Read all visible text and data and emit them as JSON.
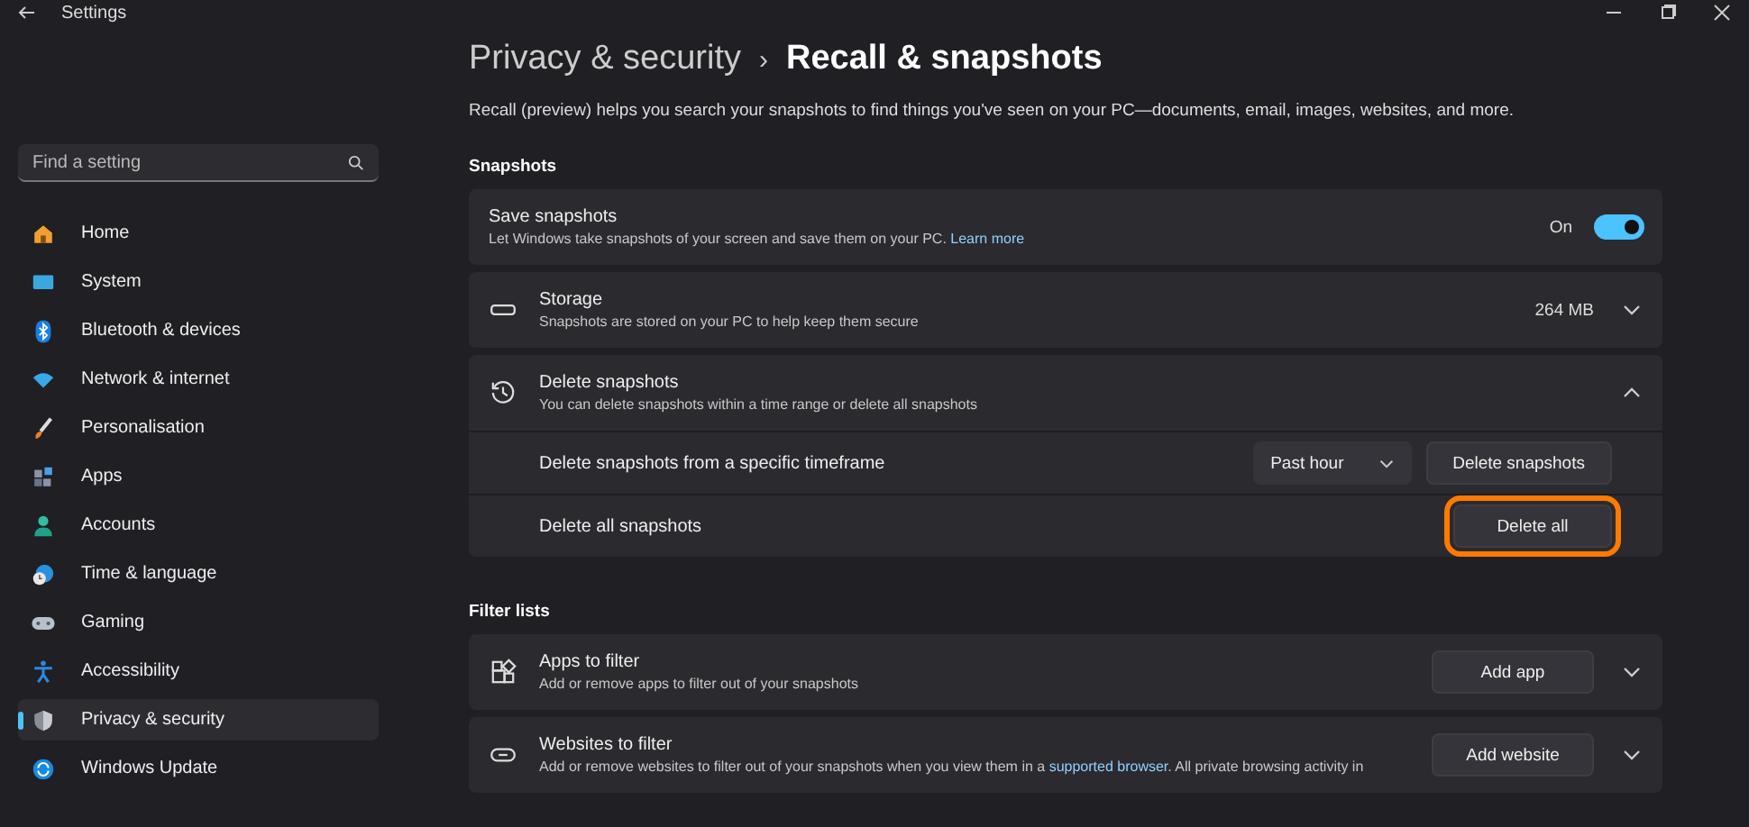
{
  "window": {
    "title": "Settings"
  },
  "search": {
    "placeholder": "Find a setting"
  },
  "nav": [
    {
      "label": "Home",
      "selected": false
    },
    {
      "label": "System",
      "selected": false
    },
    {
      "label": "Bluetooth & devices",
      "selected": false
    },
    {
      "label": "Network & internet",
      "selected": false
    },
    {
      "label": "Personalisation",
      "selected": false
    },
    {
      "label": "Apps",
      "selected": false
    },
    {
      "label": "Accounts",
      "selected": false
    },
    {
      "label": "Time & language",
      "selected": false
    },
    {
      "label": "Gaming",
      "selected": false
    },
    {
      "label": "Accessibility",
      "selected": false
    },
    {
      "label": "Privacy & security",
      "selected": true
    },
    {
      "label": "Windows Update",
      "selected": false
    }
  ],
  "breadcrumb": {
    "parent": "Privacy & security",
    "separator": "›",
    "current": "Recall & snapshots"
  },
  "description": "Recall (preview) helps you search your snapshots to find things you've seen on your PC—documents, email, images, websites, and more.",
  "sections": [
    {
      "heading": "Snapshots",
      "cards": [
        {
          "kind": "toggle",
          "title": "Save snapshots",
          "description": "Let Windows take snapshots of your screen and save them on your PC.",
          "link": "Learn more",
          "state_label": "On",
          "on": true
        },
        {
          "kind": "value",
          "title": "Storage",
          "description": "Snapshots are stored on your PC to help keep them secure",
          "value": "264 MB",
          "expanded": false
        },
        {
          "kind": "expander",
          "title": "Delete snapshots",
          "description": "You can delete snapshots within a time range or delete all snapshots",
          "expanded": true,
          "subrows": [
            {
              "label": "Delete snapshots from a specific timeframe",
              "dropdown": "Past hour",
              "button": "Delete snapshots",
              "highlighted": false
            },
            {
              "label": "Delete all snapshots",
              "button": "Delete all",
              "highlighted": true
            }
          ]
        }
      ]
    },
    {
      "heading": "Filter lists",
      "cards": [
        {
          "kind": "button",
          "title": "Apps to filter",
          "description": "Add or remove apps to filter out of your snapshots",
          "button": "Add app",
          "expanded": false
        },
        {
          "kind": "button",
          "title": "Websites to filter",
          "description": "Add or remove websites to filter out of your snapshots when you view them in a",
          "link": "supported browser",
          "description_after": ". All private browsing activity in",
          "button": "Add website",
          "expanded": false
        }
      ]
    }
  ]
}
